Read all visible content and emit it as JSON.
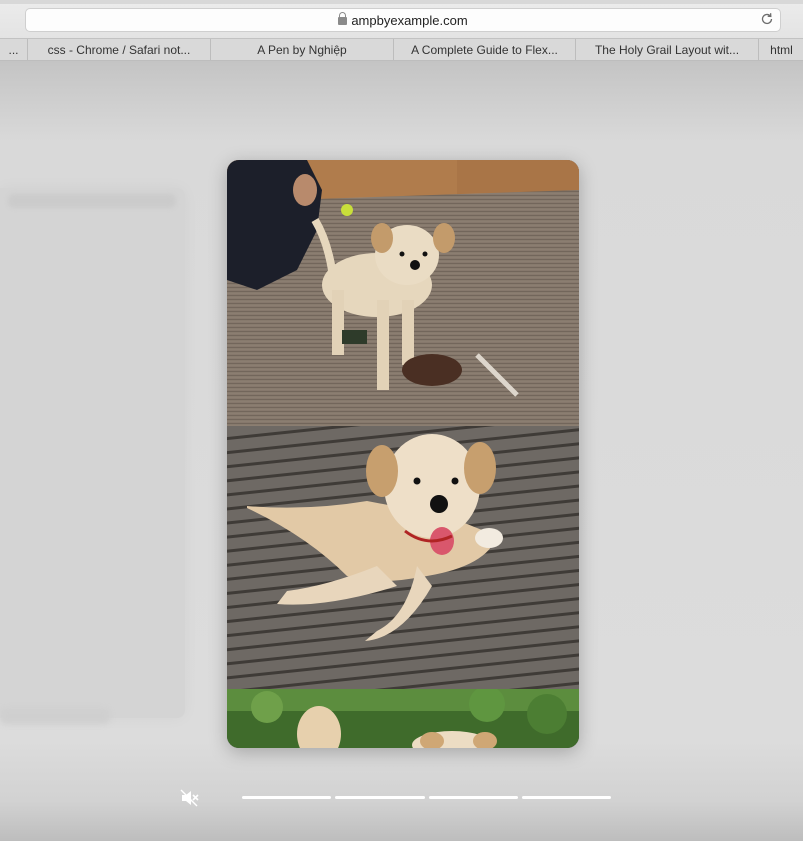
{
  "browser": {
    "url": "ampbyexample.com",
    "tabs": [
      {
        "label": "..."
      },
      {
        "label": "css - Chrome / Safari not..."
      },
      {
        "label": "A Pen by Nghiệp"
      },
      {
        "label": "A Complete Guide to Flex..."
      },
      {
        "label": "The Holy Grail Layout wit..."
      },
      {
        "label": "html"
      }
    ]
  },
  "story": {
    "pages": [
      {
        "subject": "puppy standing on rug"
      },
      {
        "subject": "puppy lying on wooden deck"
      },
      {
        "subject": "puppies in garden"
      }
    ],
    "progress": [
      1,
      1,
      1,
      1
    ]
  },
  "icons": {
    "mute": "speaker-muted-icon",
    "lock": "lock-icon",
    "reload": "reload-icon"
  },
  "colors": {
    "background": "#dadada",
    "progress": "#ffffff"
  }
}
